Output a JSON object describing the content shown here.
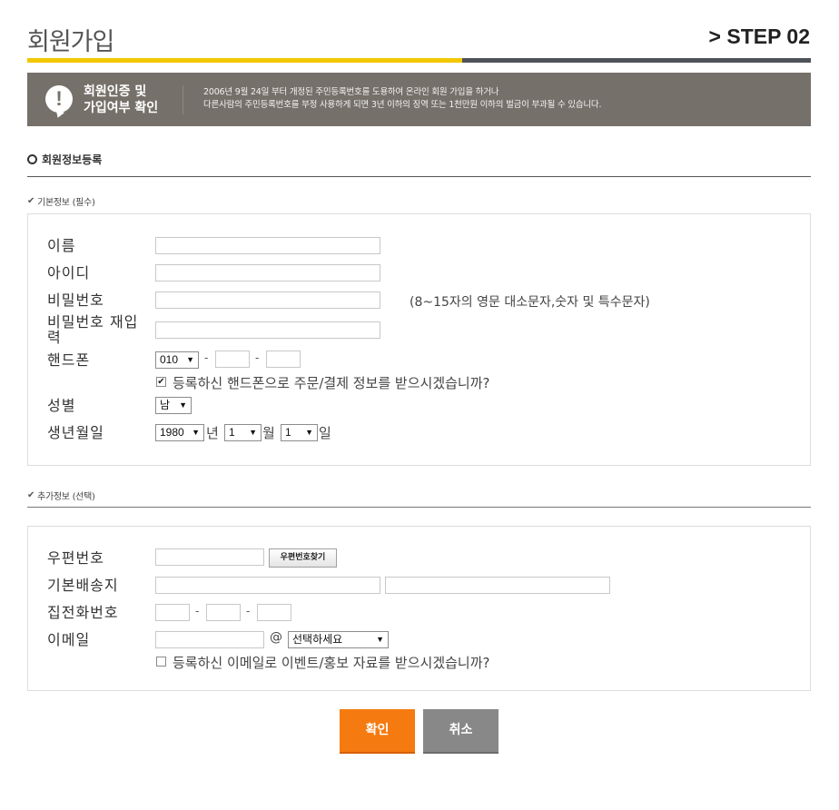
{
  "header": {
    "title": "회원가입",
    "step": "> STEP 02",
    "progress_fraction": 0.555,
    "colors": {
      "progress_fill": "#f2c700",
      "progress_track": "#4e5259"
    }
  },
  "notice": {
    "icon": "exclamation-bubble-icon",
    "title_line1": "회원인증 및",
    "title_line2": "가입여부 확인",
    "text_line1": "2006년 9월 24일 부터 개정된 주민등록번호를 도용하여 온라인 회원 가입을 하거나",
    "text_line2": "다른사람의 주민등록번호를 부정 사용하게 되면 3년 이하의 징역 또는 1천만원 이하의 벌금이 부과될 수 있습니다."
  },
  "section": {
    "title": "회원정보등록"
  },
  "basic": {
    "heading": "기본정보 (필수)",
    "name_label": "이름",
    "name_value": "",
    "id_label": "아이디",
    "id_value": "",
    "pw_label": "비밀번호",
    "pw_value": "",
    "pw_hint": "(8~15자의 영문 대소문자,숫자 및 특수문자)",
    "pw2_label_line1": "비밀번호 재입",
    "pw2_label_line2": "력",
    "pw2_value": "",
    "phone_label": "핸드폰",
    "phone_prefix": "010",
    "phone_mid": "",
    "phone_last": "",
    "dash": "-",
    "sms_checked": true,
    "sms_label": "등록하신 핸드폰으로 주문/결제 정보를 받으시겠습니까?",
    "gender_label": "성별",
    "gender_value": "남",
    "birth_label": "생년월일",
    "birth_year": "1980",
    "year_unit": "년",
    "birth_month": "1",
    "month_unit": "월",
    "birth_day": "1",
    "day_unit": "일"
  },
  "extra": {
    "heading": "추가정보 (선택)",
    "zip_label": "우편번호",
    "zip_value": "",
    "zip_button": "우편번호찾기",
    "addr_label": "기본배송지",
    "addr1_value": "",
    "addr2_value": "",
    "tel_label": "집전화번호",
    "dash": "-",
    "email_label": "이메일",
    "email_value": "",
    "at": "@",
    "email_domain": "선택하세요",
    "email_opt_checked": false,
    "email_opt_label": "등록하신 이메일로 이벤트/홍보 자료를 받으시겠습니까?"
  },
  "actions": {
    "confirm": "확인",
    "cancel": "취소",
    "colors": {
      "confirm": "#f57a0f",
      "cancel": "#888888"
    }
  }
}
